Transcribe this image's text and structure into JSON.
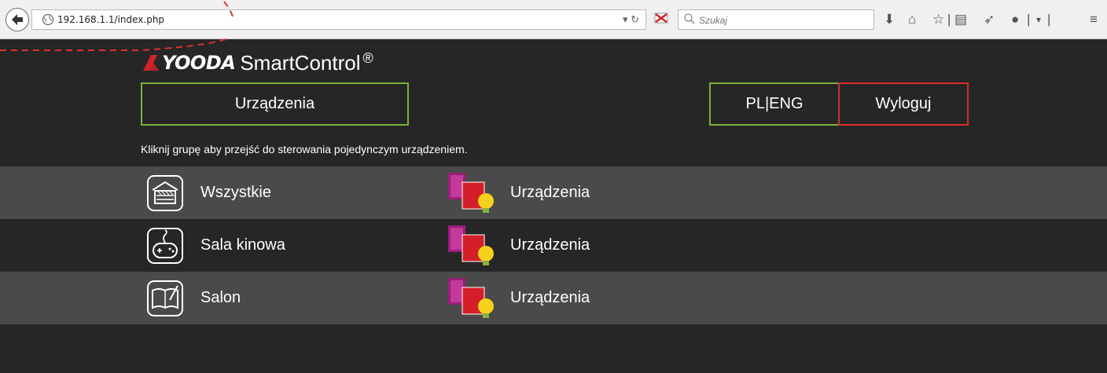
{
  "browser": {
    "url": "192.168.1.1/index.php",
    "search_placeholder": "Szukaj"
  },
  "logo": {
    "brand": "YOODA",
    "product": "SmartControl",
    "registered": "®"
  },
  "buttons": {
    "devices": "Urządzenia",
    "language": "PL|ENG",
    "logout": "Wyloguj"
  },
  "hint": "Kliknij grupę aby przejść do sterowania pojedynczym urządzeniem.",
  "groups": [
    {
      "name": "Wszystkie",
      "icon": "garage-icon",
      "devices_label": "Urządzenia"
    },
    {
      "name": "Sala kinowa",
      "icon": "gamepad-icon",
      "devices_label": "Urządzenia"
    },
    {
      "name": "Salon",
      "icon": "book-icon",
      "devices_label": "Urządzenia"
    }
  ],
  "colors": {
    "background": "#262626",
    "row_alt": "#4a4a4a",
    "accent_green": "#7ab03c",
    "accent_red": "#d92a2a"
  }
}
